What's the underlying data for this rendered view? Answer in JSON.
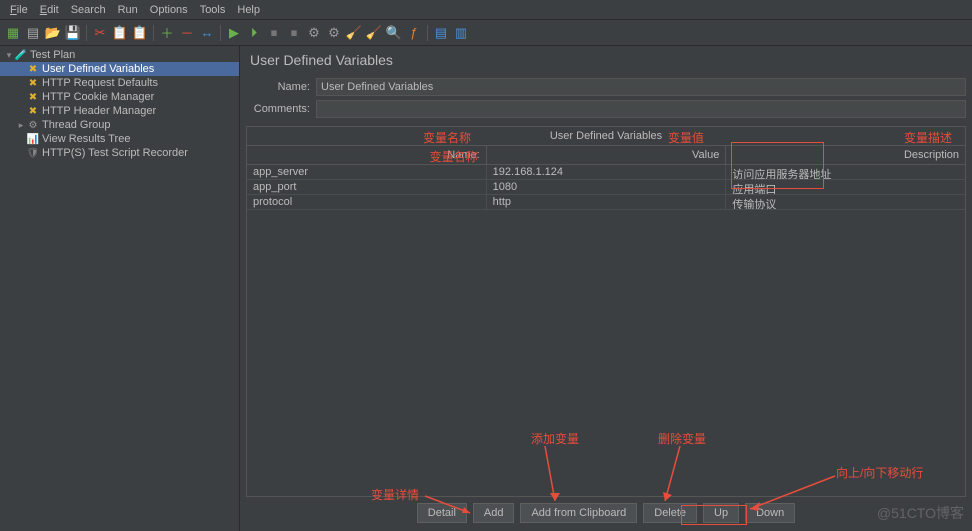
{
  "menu": {
    "file": "File",
    "edit": "Edit",
    "search": "Search",
    "run": "Run",
    "options": "Options",
    "tools": "Tools",
    "help": "Help"
  },
  "toolbar": {
    "new": "📄",
    "open": "📁",
    "close": "✖",
    "save": "💾",
    "cut": "✂",
    "copy": "📋",
    "paste": "📋",
    "expand": "➕",
    "collapse": "➖",
    "toggle": "🔀",
    "start": "▶",
    "startNo": "▶",
    "stop": "⏹",
    "shutdown": "⏹",
    "clear": "🧹",
    "clearAll": "🧹",
    "search": "🔍",
    "func": "ƒ",
    "help": "❓",
    "tpl": "📑",
    "extra": "📘"
  },
  "tree": {
    "root": "Test Plan",
    "items": [
      "User Defined Variables",
      "HTTP Request Defaults",
      "HTTP Cookie Manager",
      "HTTP Header Manager",
      "Thread Group",
      "View Results Tree",
      "HTTP(S) Test Script Recorder"
    ]
  },
  "panel": {
    "title": "User Defined Variables",
    "nameLabel": "Name:",
    "nameValue": "User Defined Variables",
    "commentsLabel": "Comments:",
    "commentsValue": "",
    "tableCaption": "User Defined Variables",
    "col1": "Name:",
    "col2": "Value",
    "col3": "Description",
    "rows": [
      {
        "name": "app_server",
        "value": "192.168.1.124",
        "desc": "访问应用服务器地址"
      },
      {
        "name": "app_port",
        "value": "1080",
        "desc": "应用端口"
      },
      {
        "name": "protocol",
        "value": "http",
        "desc": "传输协议"
      }
    ]
  },
  "buttons": {
    "detail": "Detail",
    "add": "Add",
    "addClip": "Add from Clipboard",
    "delete": "Delete",
    "up": "Up",
    "down": "Down"
  },
  "anno": {
    "colName": "变量名称",
    "colValue": "变量值",
    "colDesc": "变量描述",
    "detail": "变量详情",
    "add": "添加变量",
    "delete": "删除变量",
    "updown": "向上/向下移动行"
  },
  "watermark": "@51CTO博客"
}
